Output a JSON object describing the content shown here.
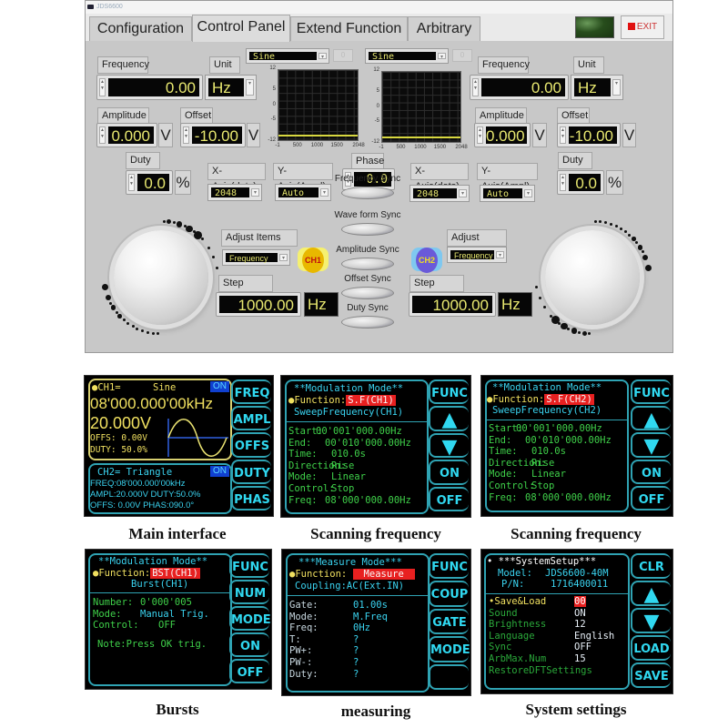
{
  "window": {
    "title": "JDS6600"
  },
  "tabs": [
    {
      "label": "Configuration",
      "active": false
    },
    {
      "label": "Control Panel",
      "active": true
    },
    {
      "label": "Extend Function",
      "active": false
    },
    {
      "label": "Arbitrary",
      "active": false
    }
  ],
  "header": {
    "exit_label": "EXIT",
    "status_led_color": "#2d5a20"
  },
  "ch1": {
    "frequency_label": "Frequency",
    "frequency_value": "0.00",
    "unit_label": "Unit",
    "unit_value": "Hz",
    "amplitude_label": "Amplitude",
    "amplitude_value": "0.000",
    "amplitude_unit": "V",
    "offset_label": "Offset",
    "offset_value": "-10.00",
    "offset_unit": "V",
    "duty_label": "Duty",
    "duty_value": "0.0",
    "duty_unit": "%",
    "waveform": "Sine",
    "wave_index": "0",
    "xaxis_label": "X-Axis(dots)",
    "xaxis_value": "2048",
    "yaxis_label": "Y-Axis(Ampl)",
    "yaxis_value": "Auto",
    "adjust_label": "Adjust Items",
    "adjust_value": "Frequency",
    "badge": "CH1",
    "step_label": "Step Value",
    "step_value": "1000.00",
    "step_unit": "Hz"
  },
  "ch2": {
    "frequency_label": "Frequency",
    "frequency_value": "0.00",
    "unit_label": "Unit",
    "unit_value": "Hz",
    "amplitude_label": "Amplitude",
    "amplitude_value": "0.000",
    "amplitude_unit": "V",
    "offset_label": "Offset",
    "offset_value": "-10.00",
    "offset_unit": "V",
    "duty_label": "Duty",
    "duty_value": "0.0",
    "duty_unit": "%",
    "waveform": "Sine",
    "wave_index": "0",
    "xaxis_label": "X-Axis(dots)",
    "xaxis_value": "2048",
    "yaxis_label": "Y-Axis(Ampl)",
    "yaxis_value": "Auto",
    "adjust_label": "Adjust Items",
    "adjust_value": "Frequency",
    "badge": "CH2",
    "step_label": "Step Value",
    "step_value": "1000.00",
    "step_unit": "Hz"
  },
  "graph": {
    "y_ticks": [
      "12",
      "5",
      "0",
      "-5",
      "-12"
    ],
    "x_ticks": [
      "-1",
      "500",
      "1000",
      "1500",
      "2048"
    ],
    "trace_level": -10
  },
  "center": {
    "phase_label": "Phase",
    "phase_value": "0.0",
    "sync": [
      "Frequency Sync",
      "Wave form Sync",
      "Amplitude Sync",
      "Offset Sync",
      "Duty  Sync"
    ]
  },
  "screens": {
    "main": {
      "caption": "Main interface",
      "ch1_title": "●CH1=",
      "ch1_wave": "Sine",
      "ch1_on": "ON",
      "ch1_freq": "08'000.000'00kHz",
      "ch1_ampl": "20.000V",
      "ch1_offs": "OFFS: 0.00V",
      "ch1_duty": "DUTY: 50.0%",
      "ch2_title": "CH2= Triangle",
      "ch2_on": "ON",
      "ch2_freq": "FREQ:08'000.000'00kHz",
      "ch2_ampl": "AMPL:20.000V DUTY:50.0%",
      "ch2_offs": "OFFS:  0.00V PHAS:090.0°",
      "softkeys": [
        "FREQ",
        "AMPL",
        "OFFS",
        "DUTY",
        "PHAS"
      ]
    },
    "sweep1": {
      "caption": "Scanning frequency",
      "title": "**Modulation Mode**",
      "function_label": "●Function:",
      "function_value": "S.F(CH1)",
      "subtitle": "SweepFrequency(CH1)",
      "rows": [
        {
          "k": "Start:",
          "v": "00'001'000.00Hz"
        },
        {
          "k": "End:",
          "v": "00'010'000.00Hz"
        },
        {
          "k": "Time:",
          "v": "010.0s"
        },
        {
          "k": "Direction:",
          "v": "Rise"
        },
        {
          "k": "Mode:",
          "v": "Linear"
        },
        {
          "k": "Control:",
          "v": "Stop"
        },
        {
          "k": "Freq:",
          "v": "08'000'000.00Hz"
        }
      ],
      "softkeys": [
        "FUNC",
        "▲",
        "▼",
        "ON",
        "OFF"
      ]
    },
    "sweep2": {
      "caption": "Scanning frequency",
      "title": "**Modulation Mode**",
      "function_label": "●Function:",
      "function_value": "S.F(CH2)",
      "subtitle": "SweepFrequency(CH2)",
      "rows": [
        {
          "k": "Start:",
          "v": "00'001'000.00Hz"
        },
        {
          "k": "End:",
          "v": "00'010'000.00Hz"
        },
        {
          "k": "Time:",
          "v": "010.0s"
        },
        {
          "k": "Direction:",
          "v": "Rise"
        },
        {
          "k": "Mode:",
          "v": "Linear"
        },
        {
          "k": "Control:",
          "v": "Stop"
        },
        {
          "k": "Freq:",
          "v": "08'000'000.00Hz"
        }
      ],
      "softkeys": [
        "FUNC",
        "▲",
        "▼",
        "ON",
        "OFF"
      ]
    },
    "burst": {
      "caption": "Bursts",
      "title": "**Modulation Mode**",
      "function_label": "●Function:",
      "function_value": "BST(CH1)",
      "subtitle": "Burst(CH1)",
      "rows": [
        {
          "k": "Number:",
          "v": "0'000'005"
        },
        {
          "k": "Mode:",
          "v": "Manual Trig."
        },
        {
          "k": "Control:",
          "v": "OFF"
        }
      ],
      "note": "Note:Press OK trig.",
      "softkeys": [
        "FUNC",
        "NUM",
        "MODE",
        "ON",
        "OFF"
      ]
    },
    "measure": {
      "caption": "measuring",
      "title": "***Measure Mode***",
      "function_label": "●Function:",
      "function_value": "Measure",
      "subtitle": "Coupling:AC(Ext.IN)",
      "rows": [
        {
          "k": "Gate:",
          "v": "01.00s"
        },
        {
          "k": "Mode:",
          "v": "M.Freq"
        },
        {
          "k": "Freq:",
          "v": "0Hz"
        },
        {
          "k": "T:",
          "v": "?"
        },
        {
          "k": "PW+:",
          "v": "?"
        },
        {
          "k": "PW-:",
          "v": "?"
        },
        {
          "k": "Duty:",
          "v": "?"
        }
      ],
      "softkeys": [
        "FUNC",
        "COUP",
        "GATE",
        "MODE",
        ""
      ]
    },
    "system": {
      "caption": "System settings",
      "title": "• ***SystemSetup***",
      "model_label": "Model:",
      "model_value": "JDS6600-40M",
      "pn_label": "P/N:",
      "pn_value": "1716400011",
      "rows": [
        {
          "k": "•Save&Load",
          "v": "00"
        },
        {
          "k": "Sound",
          "v": "ON"
        },
        {
          "k": "Brightness",
          "v": "12"
        },
        {
          "k": "Language",
          "v": "English"
        },
        {
          "k": "Sync",
          "v": "OFF"
        },
        {
          "k": "ArbMax.Num",
          "v": "15"
        },
        {
          "k": "RestoreDFTSettings",
          "v": ""
        }
      ],
      "softkeys": [
        "CLR",
        "▲",
        "▼",
        "LOAD",
        "SAVE"
      ]
    }
  }
}
